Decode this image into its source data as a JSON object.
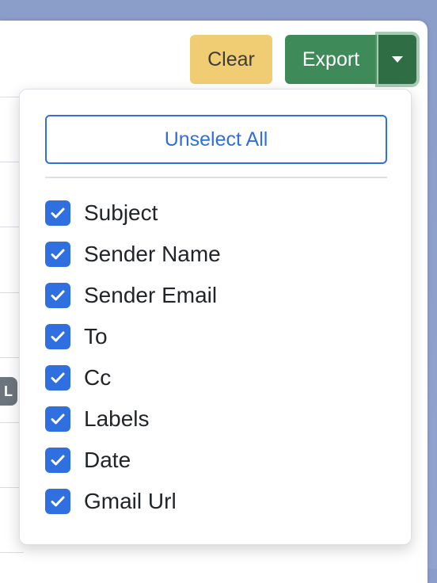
{
  "toolbar": {
    "clear_label": "Clear",
    "export_label": "Export"
  },
  "side_badge": "L",
  "dropdown": {
    "unselect_all_label": "Unselect All",
    "options": [
      {
        "label": "Subject",
        "checked": true
      },
      {
        "label": "Sender Name",
        "checked": true
      },
      {
        "label": "Sender Email",
        "checked": true
      },
      {
        "label": "To",
        "checked": true
      },
      {
        "label": "Cc",
        "checked": true
      },
      {
        "label": "Labels",
        "checked": true
      },
      {
        "label": "Date",
        "checked": true
      },
      {
        "label": "Gmail Url",
        "checked": true
      }
    ]
  },
  "colors": {
    "primary_blue": "#2f6fe0",
    "export_green": "#3e8a58",
    "export_caret_green": "#2f6e44",
    "clear_yellow": "#f0cd73"
  },
  "icons": {
    "checkbox": "checkmark-icon",
    "dropdown_toggle": "caret-down-icon"
  }
}
